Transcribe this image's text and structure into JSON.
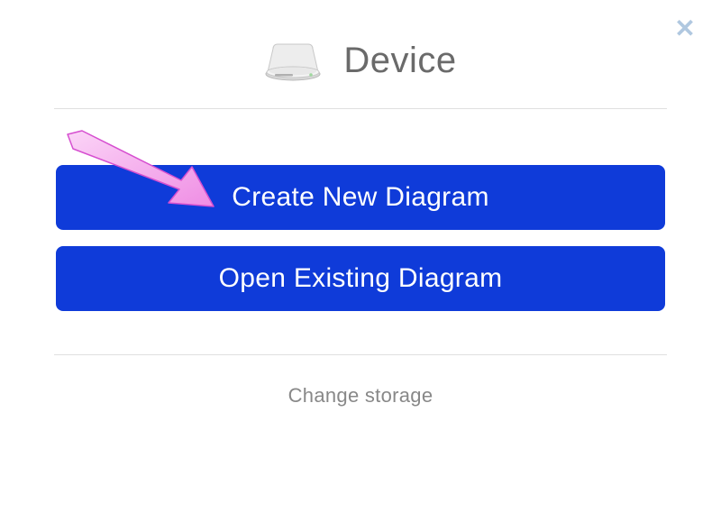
{
  "header": {
    "title": "Device"
  },
  "buttons": {
    "create_label": "Create New Diagram",
    "open_label": "Open Existing Diagram"
  },
  "footer": {
    "change_storage_label": "Change storage"
  },
  "colors": {
    "primary": "#0f3bd9",
    "close_icon": "#b0c8e0",
    "text_muted": "#6a6a6a",
    "text_footer": "#888888",
    "divider": "#e0e0e0",
    "arrow_fill": "#f29ae8",
    "arrow_stroke": "#d64fd0"
  }
}
